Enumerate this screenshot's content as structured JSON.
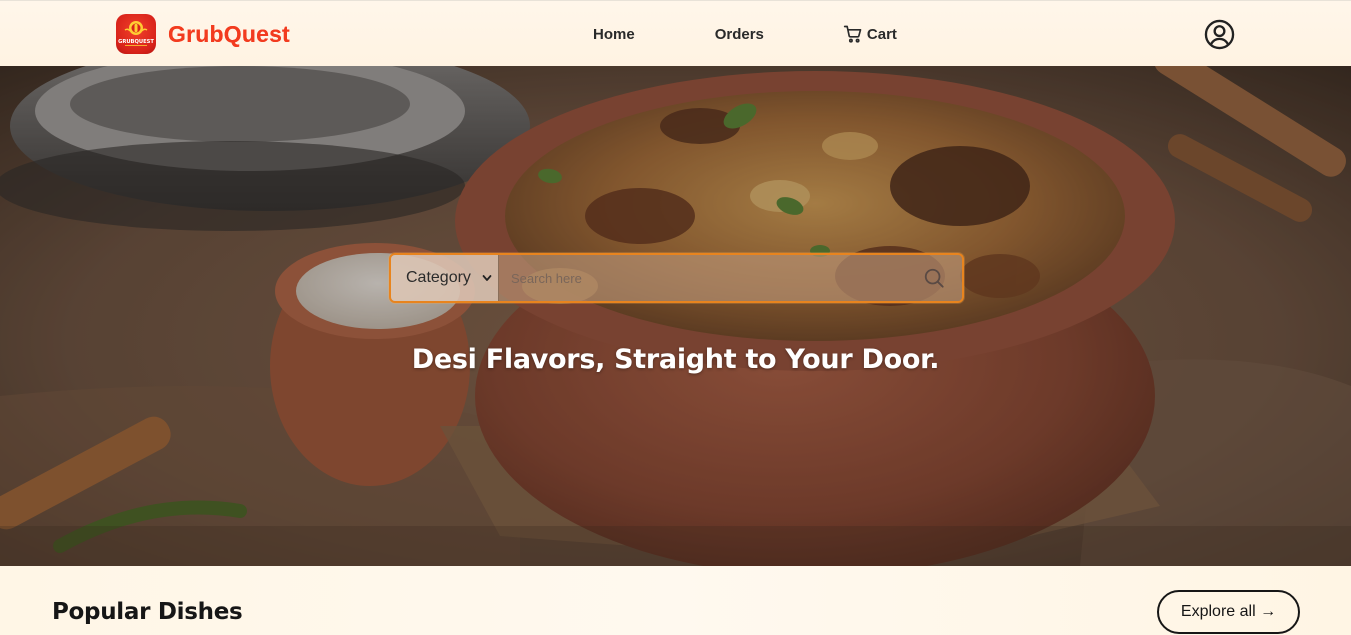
{
  "brand": {
    "name": "GrubQuest",
    "logo_text": "GRUBQUEST",
    "logo_color": "#d8221a",
    "name_color": "#f23b1f"
  },
  "nav": {
    "home": "Home",
    "orders": "Orders",
    "cart": "Cart"
  },
  "hero": {
    "category_label": "Category",
    "search_placeholder": "Search here",
    "tagline": "Desi Flavors, Straight to Your Door."
  },
  "popular": {
    "title": "Popular Dishes",
    "explore_label": "Explore all →"
  },
  "colors": {
    "accent": "#e8841e",
    "text_dark": "#161616"
  },
  "icons": [
    "cart-icon",
    "profile-icon",
    "chevron-down-icon",
    "search-icon"
  ]
}
